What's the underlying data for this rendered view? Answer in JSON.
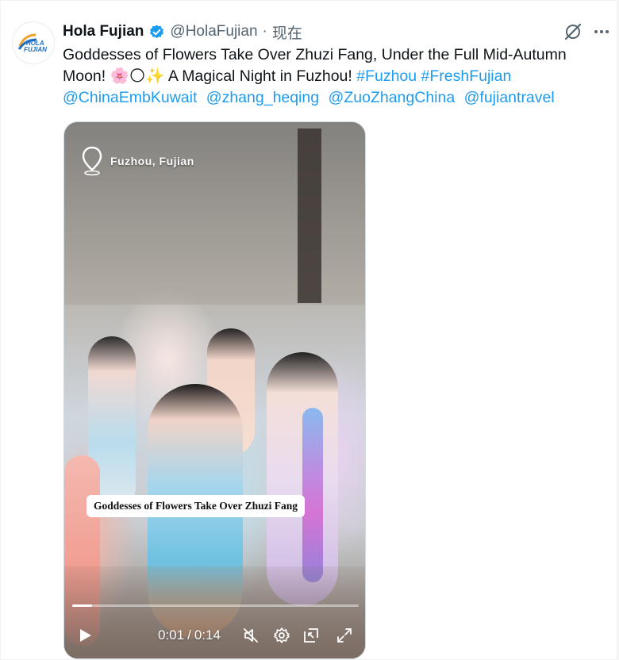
{
  "tweet": {
    "author": {
      "display_name": "Hola Fujian",
      "handle": "@HolaFujian",
      "verified": true,
      "avatar_text": "HOLA FUJIAN"
    },
    "separator": "·",
    "timestamp": "现在",
    "text_parts": {
      "line1": "Goddesses of Flowers Take Over Zhuzi Fang, Under the Full Mid-Autumn",
      "line2": "Moon! 🌸🌕✨ A Magical Night in Fuzhou!",
      "hashtags": [
        "#Fuzhou",
        "#FreshFujian"
      ],
      "mentions": [
        "@ChinaEmbKuwait",
        "@zhang_heqing",
        "@ZuoZhangChina",
        "@fujiantravel"
      ]
    },
    "icons": {
      "grok": "grok-icon",
      "more": "more-icon",
      "verified": "verified-badge-icon"
    },
    "colors": {
      "link": "#1d9bf0",
      "verified": "#1d9bf0",
      "secondary_text": "#536471"
    }
  },
  "video": {
    "location_label": "Fuzhou, Fujian",
    "caption": "Goddesses of Flowers Take Over Zhuzi Fang",
    "time_current": "0:01",
    "time_separator": "/",
    "time_total": "0:14",
    "progress_fraction": 0.07,
    "controls": [
      "play-icon",
      "mute-icon",
      "settings-icon",
      "picture-in-picture-icon",
      "fullscreen-icon"
    ]
  }
}
